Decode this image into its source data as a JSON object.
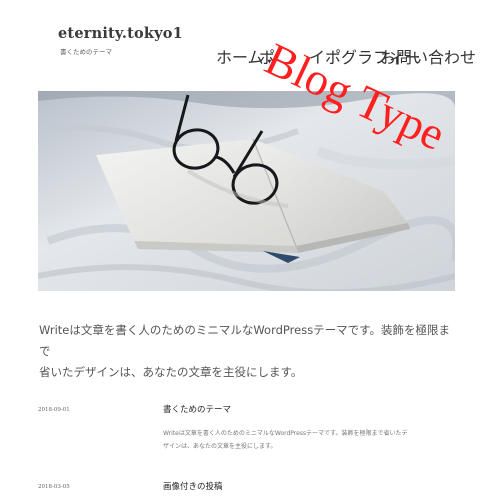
{
  "site": {
    "title": "eternity.tokyo1",
    "description": "書くためのテーマ"
  },
  "nav": {
    "items": [
      {
        "label": "ホーム",
        "has_submenu": true
      },
      {
        "label": "ポ"
      },
      {
        "label": "イポグラフィー"
      },
      {
        "label": "お問い合わせ"
      }
    ],
    "caret": "▼"
  },
  "hero": {
    "icon": "book-with-glasses-photo"
  },
  "intro": {
    "line1": "Writeは文章を書く人のためのミニマルなWordPressテーマです。装飾を極限まで",
    "line2": "省いたデザインは、あなたの文章を主役にします。"
  },
  "posts": [
    {
      "date": "2018-09-01",
      "title": "書くためのテーマ",
      "excerpt_line1": "Writeは文章を書く人のためのミニマルなWordPressテーマです。装飾を極限まで省いたデ",
      "excerpt_line2": "ザインは、あなたの文章を主役にします。"
    },
    {
      "date": "2018-03-05",
      "title": "画像付きの投稿"
    }
  ],
  "stamp": {
    "text": "Blog Type",
    "color": "#ff1f1f"
  }
}
